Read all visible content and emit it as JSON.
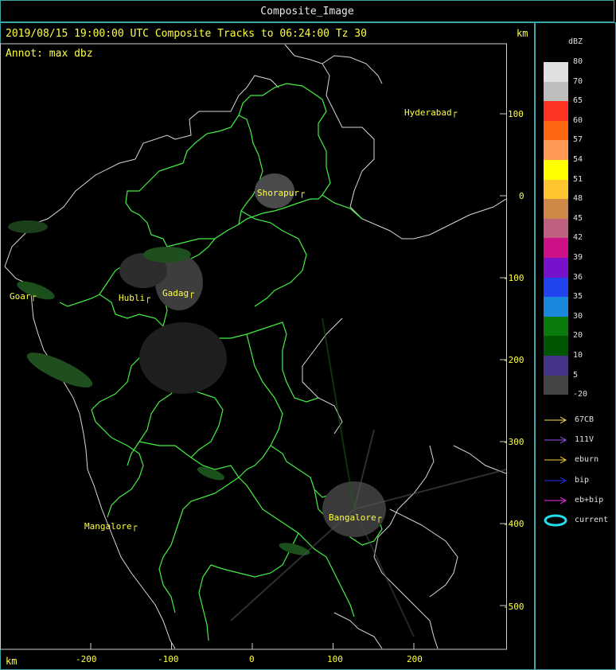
{
  "window": {
    "title": "Composite_Image"
  },
  "header": {
    "line1": "2019/08/15 19:00:00 UTC Composite Tracks to 06:24:00 Tz 30",
    "line2": "Annot: max dbz",
    "km_label_top": "km",
    "km_label_bottom": "km"
  },
  "axes": {
    "y_ticks": [
      {
        "label": "100",
        "value": 100
      },
      {
        "label": "0",
        "value": 0
      },
      {
        "label": "-100",
        "value": -100
      },
      {
        "label": "-200",
        "value": -200
      },
      {
        "label": "-300",
        "value": -300
      },
      {
        "label": "-400",
        "value": -400
      },
      {
        "label": "-500",
        "value": -500
      }
    ],
    "x_ticks": [
      {
        "label": "-200",
        "value": -200
      },
      {
        "label": "-100",
        "value": -100
      },
      {
        "label": "0",
        "value": 0
      },
      {
        "label": "100",
        "value": 100
      },
      {
        "label": "200",
        "value": 200
      }
    ]
  },
  "cities": [
    {
      "name": "Hyderabad",
      "id": "hyderabad"
    },
    {
      "name": "Shorapur",
      "id": "shorapur"
    },
    {
      "name": "Goar",
      "id": "goar"
    },
    {
      "name": "Hubli",
      "id": "hubli"
    },
    {
      "name": "Gadag",
      "id": "gadag"
    },
    {
      "name": "Mangalore",
      "id": "mangalore"
    },
    {
      "name": "Bangalore",
      "id": "bangalore"
    }
  ],
  "legend": {
    "title": "dBZ",
    "scale": [
      {
        "label": "80",
        "color": "#e0e0e0"
      },
      {
        "label": "70",
        "color": "#bdbdbd"
      },
      {
        "label": "65",
        "color": "#ff3322"
      },
      {
        "label": "60",
        "color": "#ff6611"
      },
      {
        "label": "57",
        "color": "#ff9955"
      },
      {
        "label": "54",
        "color": "#ffff00"
      },
      {
        "label": "51",
        "color": "#ffc430"
      },
      {
        "label": "48",
        "color": "#cc8844"
      },
      {
        "label": "45",
        "color": "#c06080"
      },
      {
        "label": "42",
        "color": "#cc1188"
      },
      {
        "label": "39",
        "color": "#7711cc"
      },
      {
        "label": "36",
        "color": "#2244ee"
      },
      {
        "label": "35",
        "color": "#1a88dd"
      },
      {
        "label": "30",
        "color": "#0a7a0a"
      },
      {
        "label": "20",
        "color": "#005500"
      },
      {
        "label": "10",
        "color": "#443388"
      },
      {
        "label": "5",
        "color": "#444444"
      },
      {
        "label": "-20",
        "color": "#000000"
      }
    ],
    "tracks": [
      {
        "label": "67CB",
        "color": "#ffdd55"
      },
      {
        "label": "111V",
        "color": "#9955ee"
      },
      {
        "label": "eburn",
        "color": "#ffcc33"
      },
      {
        "label": "bip",
        "color": "#2233ee"
      },
      {
        "label": "eb+bip",
        "color": "#ee33ee"
      },
      {
        "label": "current",
        "color": "#22ddee"
      }
    ]
  },
  "colors": {
    "frame": "#3aa6a6",
    "boundary_state": "#44ee44",
    "boundary_country": "#e0e0e0",
    "annotation": "#ffff40"
  }
}
